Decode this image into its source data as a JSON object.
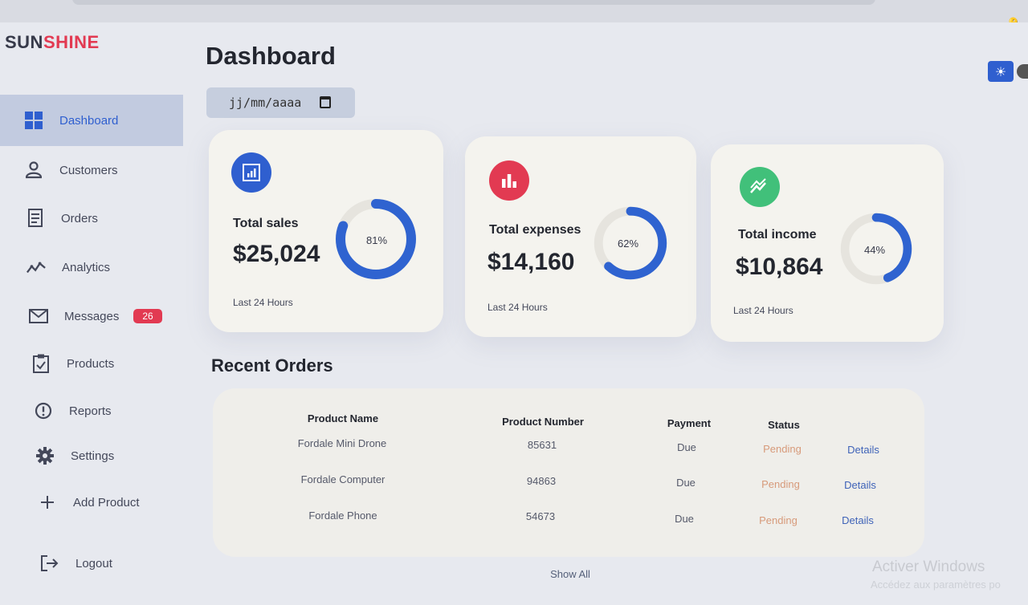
{
  "brand": {
    "part1": "SUN",
    "part2": "SHINE"
  },
  "sidebar": {
    "items": [
      {
        "label": "Dashboard",
        "icon": "grid-icon"
      },
      {
        "label": "Customers",
        "icon": "user-icon"
      },
      {
        "label": "Orders",
        "icon": "receipt-icon"
      },
      {
        "label": "Analytics",
        "icon": "analytics-icon"
      },
      {
        "label": "Messages",
        "icon": "mail-icon",
        "badge": "26"
      },
      {
        "label": "Products",
        "icon": "clipboard-icon"
      },
      {
        "label": "Reports",
        "icon": "alert-icon"
      },
      {
        "label": "Settings",
        "icon": "gear-icon"
      },
      {
        "label": "Add Product",
        "icon": "plus-icon"
      },
      {
        "label": "Logout",
        "icon": "logout-icon"
      }
    ]
  },
  "header": {
    "title": "Dashboard",
    "date_placeholder": "jj/mm/aaaa"
  },
  "cards": [
    {
      "label": "Total sales",
      "amount": "$25,024",
      "percent_text": "81%",
      "percent": 81,
      "period": "Last 24 Hours",
      "icon": "bar-chart-icon",
      "icon_color": "#2f5fcf"
    },
    {
      "label": "Total expenses",
      "amount": "$14,160",
      "percent_text": "62%",
      "percent": 62,
      "period": "Last 24 Hours",
      "icon": "bar-chart-icon",
      "icon_color": "#e23a52"
    },
    {
      "label": "Total income",
      "amount": "$10,864",
      "percent_text": "44%",
      "percent": 44,
      "period": "Last 24 Hours",
      "icon": "trend-icon",
      "icon_color": "#41c07a"
    }
  ],
  "recent_orders": {
    "title": "Recent Orders",
    "columns": [
      "Product Name",
      "Product Number",
      "Payment",
      "Status"
    ],
    "rows": [
      {
        "name": "Fordale Mini Drone",
        "number": "85631",
        "payment": "Due",
        "status": "Pending",
        "action": "Details"
      },
      {
        "name": "Fordale Computer",
        "number": "94863",
        "payment": "Due",
        "status": "Pending",
        "action": "Details"
      },
      {
        "name": "Fordale Phone",
        "number": "54673",
        "payment": "Due",
        "status": "Pending",
        "action": "Details"
      }
    ],
    "show_all": "Show All"
  },
  "watermark": {
    "line1": "Activer Windows",
    "line2": "Accédez aux paramètres po"
  },
  "colors": {
    "accent": "#2f5fcf",
    "danger": "#e23a52",
    "success": "#41c07a",
    "warning": "#d79a7a"
  }
}
